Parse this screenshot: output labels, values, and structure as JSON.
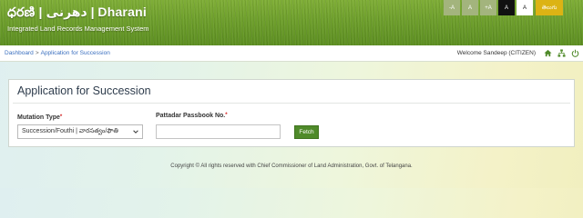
{
  "header": {
    "title": "ధరణి | دھرنی | Dharani",
    "subtitle": "Integrated Land Records Management System",
    "font_controls": [
      "-A",
      "A",
      "+A",
      "A",
      "A"
    ],
    "language": "తెలుగు"
  },
  "nav": {
    "breadcrumb": [
      "Dashboard",
      "Application for Succession"
    ],
    "welcome": "Welcome  Sandeep (CITIZEN)",
    "icons": [
      "home-icon",
      "sitemap-icon",
      "power-icon"
    ]
  },
  "form": {
    "title": "Application for Succession",
    "mutation_type_label": "Mutation Type",
    "mutation_type_value": "Succession/Fouthi | వారసత్వం/ఫౌతి",
    "pattadar_label": "Pattadar Passbook No.",
    "pattadar_value": "",
    "fetch_label": "Fetch"
  },
  "footer": {
    "text": "Copyright © All rights reserved with Chief Commissioner of Land Administration, Govt. of Telangana."
  },
  "colors": {
    "header_green": "#6e9f2c",
    "link_blue": "#3a6fbf",
    "button_green": "#4f8a2a",
    "language_yellow": "#dcb314"
  }
}
